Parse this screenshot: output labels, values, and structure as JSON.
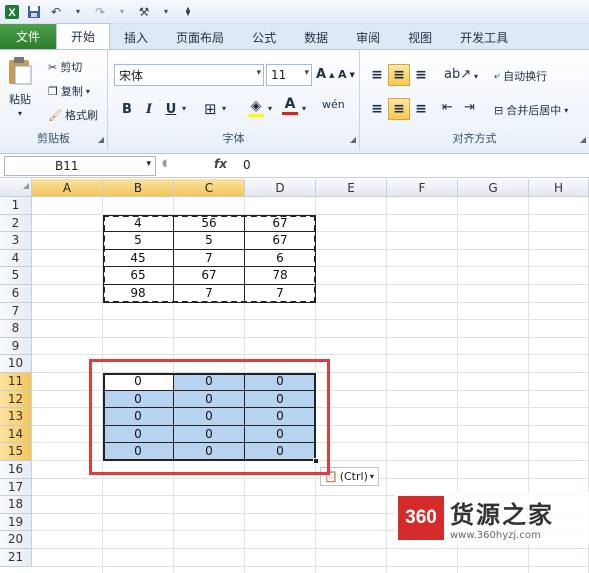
{
  "tabs": {
    "file": "文件",
    "home": "开始",
    "insert": "插入",
    "layout": "页面布局",
    "formula": "公式",
    "data": "数据",
    "review": "审阅",
    "view": "视图",
    "dev": "开发工具"
  },
  "clipboard": {
    "paste": "粘贴",
    "cut": "剪切",
    "copy": "复制",
    "painter": "格式刷",
    "label": "剪贴板"
  },
  "font": {
    "name": "宋体",
    "size": "11",
    "label": "字体"
  },
  "align": {
    "wrap": "自动换行",
    "merge": "合并后居中",
    "label": "对齐方式"
  },
  "formula_bar": {
    "name_box": "B11",
    "value": "0"
  },
  "grid": {
    "columns": [
      "A",
      "B",
      "C",
      "D",
      "E",
      "F",
      "G",
      "H"
    ],
    "rows": [
      "1",
      "2",
      "3",
      "4",
      "5",
      "6",
      "7",
      "8",
      "9",
      "10",
      "11",
      "12",
      "13",
      "14",
      "15",
      "16",
      "17",
      "18",
      "19",
      "20",
      "21"
    ],
    "source_values": [
      [
        "4",
        "56",
        "67"
      ],
      [
        "5",
        "5",
        "67"
      ],
      [
        "45",
        "7",
        "6"
      ],
      [
        "65",
        "67",
        "78"
      ],
      [
        "98",
        "7",
        "7"
      ]
    ],
    "pasted_values": [
      [
        "0",
        "0",
        "0"
      ],
      [
        "0",
        "0",
        "0"
      ],
      [
        "0",
        "0",
        "0"
      ],
      [
        "0",
        "0",
        "0"
      ],
      [
        "0",
        "0",
        "0"
      ]
    ]
  },
  "paste_options": {
    "label": "(Ctrl)"
  },
  "watermark": {
    "logo": "360",
    "name": "货源之家",
    "url": "www.360hyzj.com"
  },
  "colors": {
    "accent": "#2b7d2b",
    "selection": "#b7d3f0",
    "highlight": "#e33b3b",
    "header_hl": "#f5c65a"
  }
}
